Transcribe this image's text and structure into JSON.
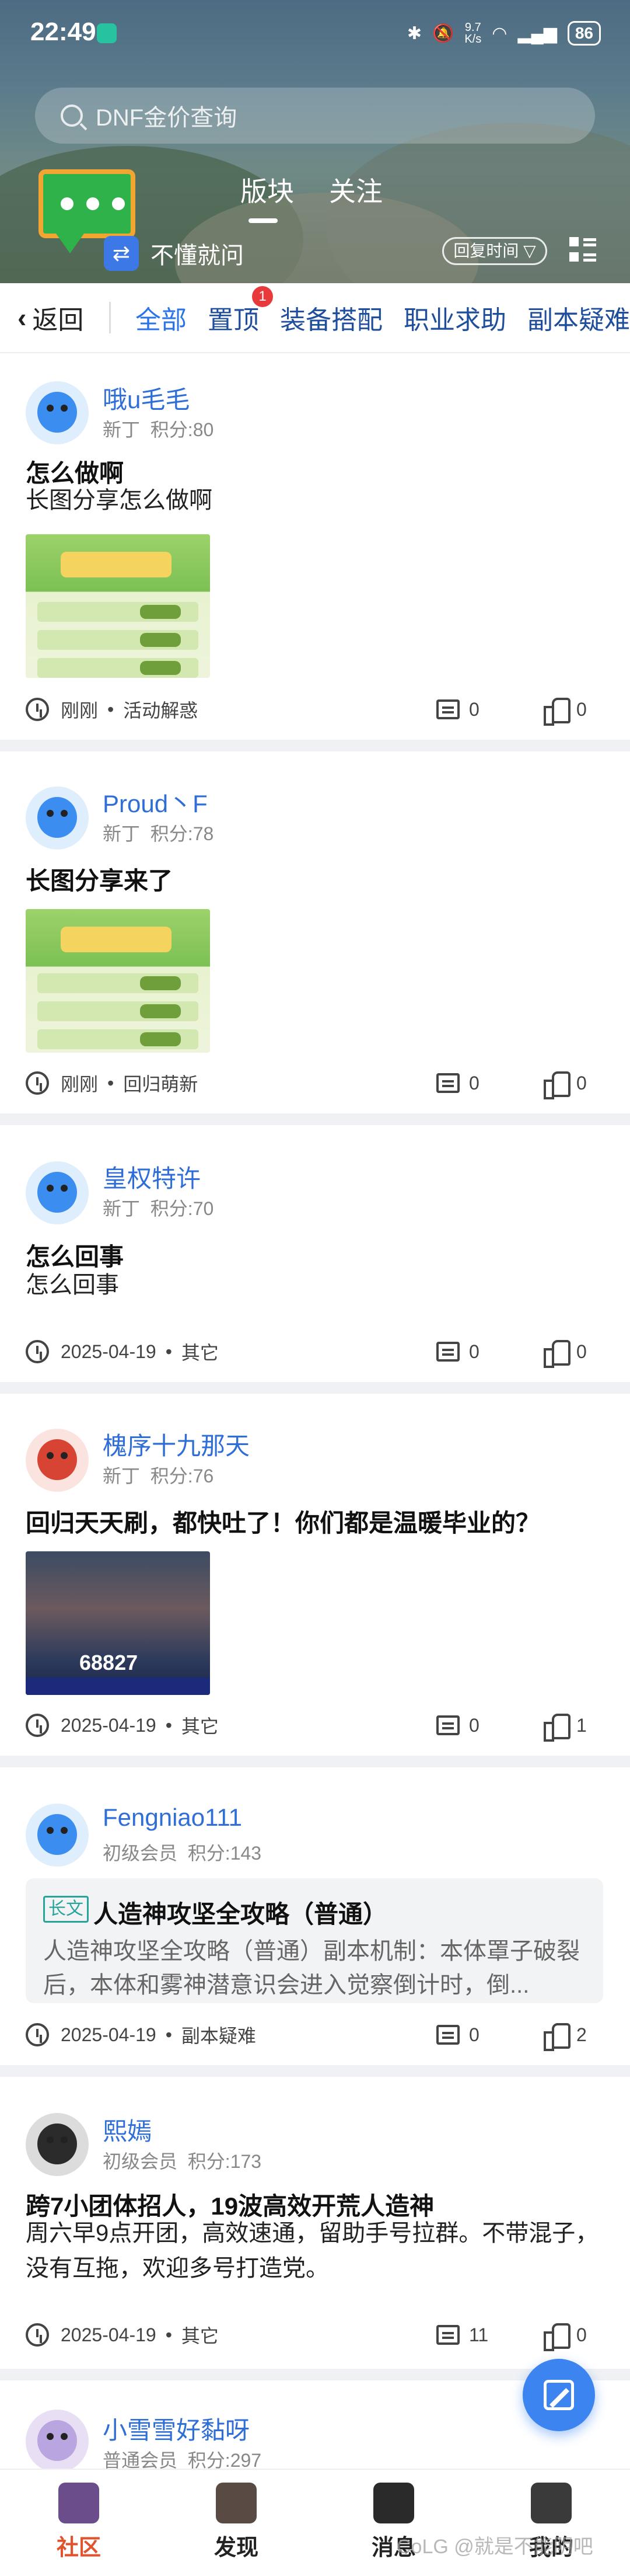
{
  "status_bar": {
    "time": "22:49",
    "net_speed_value": "9.7",
    "net_speed_unit": "K/s",
    "battery": "86"
  },
  "header": {
    "search_placeholder": "DNF金价查询",
    "tabs": [
      {
        "label": "版块",
        "active": true
      },
      {
        "label": "关注",
        "active": false
      }
    ],
    "ask_label": "不懂就问",
    "sort_label": "回复时间 ▽"
  },
  "category_nav": {
    "back_label": "返回",
    "items": [
      {
        "label": "全部",
        "active": true
      },
      {
        "label": "置顶",
        "badge": "1"
      },
      {
        "label": "装备搭配"
      },
      {
        "label": "职业求助"
      },
      {
        "label": "副本疑难"
      }
    ]
  },
  "posts": [
    {
      "username": "哦u毛毛",
      "level": "新丁",
      "points": "积分:80",
      "title": "怎么做啊",
      "body": "长图分享怎么做啊",
      "has_image": true,
      "time": "刚刚",
      "category": "活动解惑",
      "comments": "0",
      "likes": "0"
    },
    {
      "username": "Proud丶F",
      "level": "新丁",
      "points": "积分:78",
      "title": "长图分享来了",
      "has_image": true,
      "time": "刚刚",
      "category": "回归萌新",
      "comments": "0",
      "likes": "0"
    },
    {
      "username": "皇权特许",
      "level": "新丁",
      "points": "积分:70",
      "title": "怎么回事",
      "body": "怎么回事",
      "time": "2025-04-19",
      "category": "其它",
      "comments": "0",
      "likes": "0"
    },
    {
      "username": "槐序十九那天",
      "level": "新丁",
      "points": "积分:76",
      "title": "回归天天刷，都快吐了！你们都是温暖毕业的？",
      "has_image": true,
      "image_number": "68827",
      "time": "2025-04-19",
      "category": "其它",
      "comments": "0",
      "likes": "1"
    },
    {
      "username": "Fengniao111",
      "level": "初级会员",
      "points": "积分:143",
      "long_tag": "长文",
      "long_title": "人造神攻坚全攻略（普通）",
      "long_desc": "人造神攻坚全攻略（普通）副本机制：本体罩子破裂后，本体和雾神潜意识会进入觉察倒计时，倒...",
      "time": "2025-04-19",
      "category": "副本疑难",
      "comments": "0",
      "likes": "2"
    },
    {
      "username": "熙嫣",
      "level": "初级会员",
      "points": "积分:173",
      "title": "跨7小团体招人，19波高效开荒人造神",
      "body": "周六早9点开团，高效速通，留助手号拉群。不带混子，没有互拖，欢迎多号打造党。",
      "time": "2025-04-19",
      "category": "其它",
      "comments": "11",
      "likes": "0"
    },
    {
      "username": "小雪雪好黏呀",
      "level": "普通会员",
      "points": "积分:297"
    }
  ],
  "tabbar": [
    {
      "label": "社区",
      "active": true
    },
    {
      "label": "发现"
    },
    {
      "label": "消息"
    },
    {
      "label": "我的"
    }
  ],
  "watermark": "CoLG @就是不能阴吧",
  "colors": {
    "accent": "#2b74e8",
    "username": "#2f6ed6",
    "badge": "#e83a3a",
    "active_tab": "#e0532d"
  }
}
